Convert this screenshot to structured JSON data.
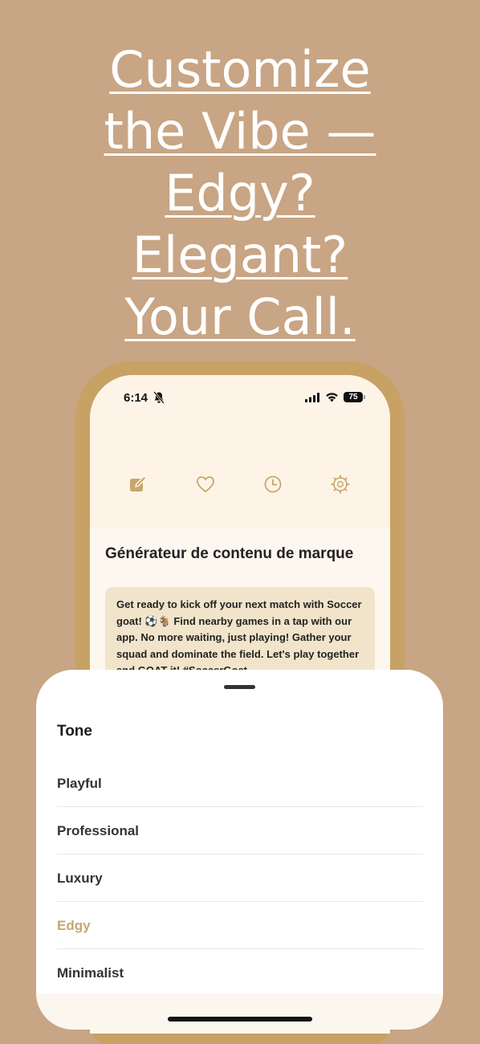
{
  "headline": {
    "line1": "Customize",
    "line2": "the Vibe —",
    "line3": "Edgy?",
    "line4": "Elegant?",
    "line5": "Your Call."
  },
  "status_bar": {
    "time": "6:14",
    "battery": "75"
  },
  "tabs": [
    {
      "icon": "compose-icon"
    },
    {
      "icon": "heart-icon"
    },
    {
      "icon": "clock-icon"
    },
    {
      "icon": "gear-icon"
    }
  ],
  "page": {
    "title": "Générateur de contenu de marque",
    "generated_text": "Get ready to kick off your next match with Soccer goat! ⚽🐐 Find nearby games in a tap with our app. No more waiting, just playing! Gather your squad and dominate the field. Let's play together and GOAT it! #SoccerGoat"
  },
  "sheet": {
    "title": "Tone",
    "options": [
      {
        "label": "Playful"
      },
      {
        "label": "Professional"
      },
      {
        "label": "Luxury"
      },
      {
        "label": "Edgy"
      },
      {
        "label": "Minimalist"
      }
    ],
    "selected": "Edgy"
  },
  "colors": {
    "background": "#c8a584",
    "accent": "#c9a66b",
    "card": "#f2e4ca",
    "phone_frame": "#c8a165"
  }
}
